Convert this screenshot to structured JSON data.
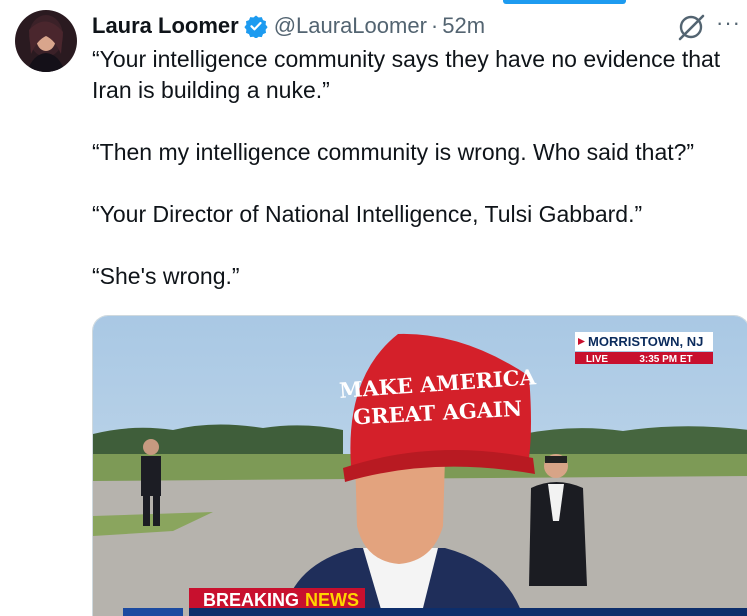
{
  "tweet": {
    "author_name": "Laura Loomer",
    "handle": "@LauraLoomer",
    "separator": "·",
    "time": "52m",
    "more_label": "···",
    "paragraphs": [
      "“Your intelligence community says they have no evidence that Iran is building a nuke.”",
      "“Then my intelligence community is wrong. Who said that?”",
      "“Your Director of National Intelligence, Tulsi Gabbard.”",
      "“She's wrong.”"
    ]
  },
  "media": {
    "location": "MORRISTOWN, NJ",
    "live_label": "LIVE",
    "live_time": "3:35 PM ET",
    "hat_line1": "MAKE AMERICA",
    "hat_line2": "GREAT AGAIN",
    "banner_word1": "BREAKING",
    "banner_word2": "NEWS"
  },
  "colors": {
    "verified_blue": "#1d9bf0",
    "secondary_text": "#536471",
    "hat_red": "#d4202a",
    "banner_red": "#c8102e"
  }
}
